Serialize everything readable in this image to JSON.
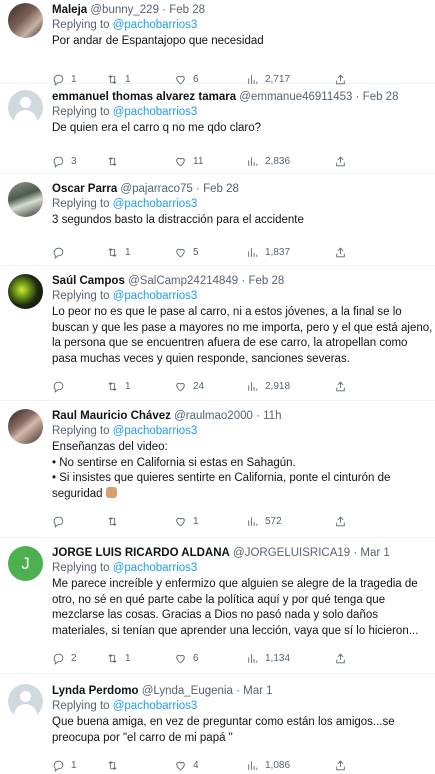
{
  "tweets": [
    {
      "name": "Maleja",
      "handle": "@bunny_229",
      "time": "Feb 28",
      "replying_prefix": "Replying to ",
      "replying_to": "@pachobarrios3",
      "lines": [
        "Por andar de Espantajopo  que necesidad"
      ],
      "replies": "1",
      "retweets": "1",
      "likes": "6",
      "views": "2,717"
    },
    {
      "name": "emmanuel thomas alvarez tamara",
      "handle": "@emmanue46911453",
      "time": "Feb 28",
      "replying_prefix": "Replying to ",
      "replying_to": "@pachobarrios3",
      "lines": [
        "De quien era el carro q no me qdo claro?"
      ],
      "replies": "3",
      "retweets": "",
      "likes": "11",
      "views": "2,836"
    },
    {
      "name": "Oscar Parra",
      "handle": "@pajarraco75",
      "time": "Feb 28",
      "replying_prefix": "Replying to ",
      "replying_to": "@pachobarrios3",
      "lines": [
        "3 segundos basto la distracción para el accidente"
      ],
      "replies": "",
      "retweets": "1",
      "likes": "5",
      "views": "1,837"
    },
    {
      "name": "Saúl Campos",
      "handle": "@SalCamp24214849",
      "time": "Feb 28",
      "replying_prefix": "Replying to ",
      "replying_to": "@pachobarrios3",
      "lines": [
        "Lo peor no es que le pase al carro, ni a estos jóvenes, a la final se lo",
        "buscan y que les pase a mayores no me importa, pero y el que está ajeno,",
        "la persona que se encuentren afuera de ese carro, la atropellan como",
        "pasa muchas veces y quien responde, sanciones severas."
      ],
      "replies": "",
      "retweets": "1",
      "likes": "24",
      "views": "2,918"
    },
    {
      "name": "Raul Mauricio Chávez",
      "handle": "@raulmao2000",
      "time": "11h",
      "replying_prefix": "Replying to ",
      "replying_to": "@pachobarrios3",
      "lines": [
        "Enseñanzas del video:",
        "• No sentirse en California si estas en Sahagún.",
        "• Si insistes que quieres sentirte en California, ponte el cinturón de",
        "seguridad"
      ],
      "replies": "",
      "retweets": "",
      "likes": "1",
      "views": "572"
    },
    {
      "name": "JORGE LUIS RICARDO ALDANA",
      "handle": "@JORGELUISRICA19",
      "time": "Mar 1",
      "avatar_letter": "J",
      "replying_prefix": "Replying to ",
      "replying_to": "@pachobarrios3",
      "lines": [
        "Me parece increíble y enfermizo que alguien se alegre de la tragedia de",
        "otro, no sé en qué parte cabe la política aquí y por qué tenga que",
        "mezclarse las cosas. Gracias a Dios no pasó nada y solo daños",
        "materiales, si tenían que aprender una lección, vaya que sí lo hicieron..."
      ],
      "replies": "2",
      "retweets": "1",
      "likes": "6",
      "views": "1,134"
    },
    {
      "name": "Lynda Perdomo",
      "handle": "@Lynda_Eugenia",
      "time": "Mar 1",
      "replying_prefix": "Replying to ",
      "replying_to": "@pachobarrios3",
      "lines": [
        "Que buena amiga, en vez de preguntar como están los amigos...se",
        "preocupa por \"el carro de mi papá \""
      ],
      "replies": "1",
      "retweets": "",
      "likes": "4",
      "views": "1,086"
    }
  ]
}
